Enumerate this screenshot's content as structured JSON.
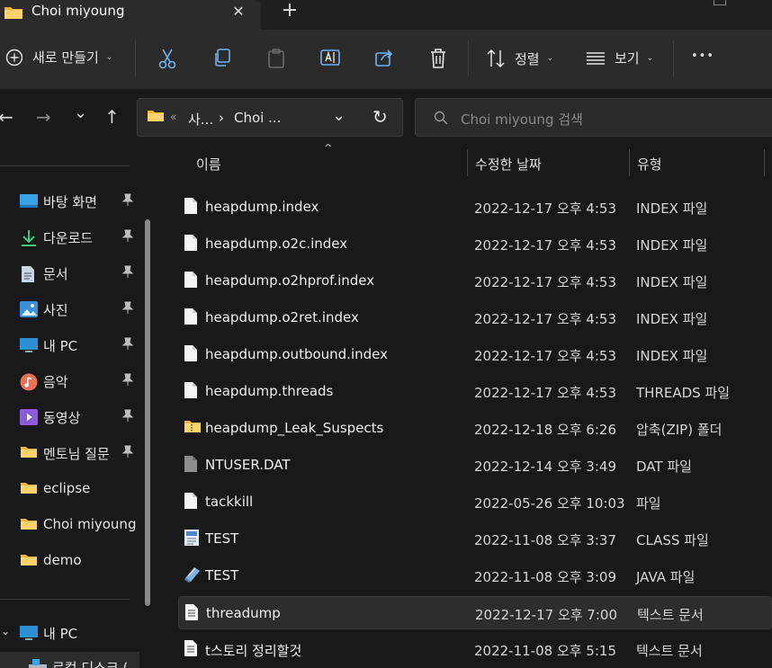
{
  "window": {
    "tab_title": "Choi miyoung",
    "close_glyph": "✕",
    "new_tab_glyph": "+"
  },
  "toolbar": {
    "new_label": "새로 만들기",
    "sort_label": "정렬",
    "view_label": "보기",
    "caret": "⌄",
    "more_glyph": "•••"
  },
  "navigation": {
    "back": "←",
    "forward": "→",
    "recent": "⌄",
    "up": "↑",
    "address": {
      "overflow": "«",
      "crumb1": "사...",
      "sep": "›",
      "crumb2": "Choi ...",
      "dropdown": "⌄",
      "refresh": "↻"
    },
    "search_placeholder": "Choi miyoung 검색"
  },
  "sidebar": {
    "pin_glyph": "📌",
    "items": [
      {
        "label": "바탕 화면",
        "icon": "desktop-icon",
        "pinned": true
      },
      {
        "label": "다운로드",
        "icon": "download-icon",
        "pinned": true
      },
      {
        "label": "문서",
        "icon": "document-icon",
        "pinned": true
      },
      {
        "label": "사진",
        "icon": "pictures-icon",
        "pinned": true
      },
      {
        "label": "내 PC",
        "icon": "pc-icon",
        "pinned": true
      },
      {
        "label": "음악",
        "icon": "music-icon",
        "pinned": true
      },
      {
        "label": "동영상",
        "icon": "video-icon",
        "pinned": true
      },
      {
        "label": "멘토님 질문",
        "icon": "folder-icon",
        "pinned": true
      },
      {
        "label": "eclipse",
        "icon": "folder-icon",
        "pinned": false
      },
      {
        "label": "Choi miyoung",
        "icon": "folder-icon",
        "pinned": false
      },
      {
        "label": "demo",
        "icon": "folder-icon",
        "pinned": false
      }
    ],
    "this_pc": {
      "label": "내 PC",
      "expand": "⌄"
    },
    "local_disk": {
      "label": "로컬 디스크 ("
    }
  },
  "list": {
    "columns": {
      "name": "이름",
      "date": "수정한 날짜",
      "type": "유형"
    },
    "sort_glyph": "^",
    "rows": [
      {
        "name": "heapdump.index",
        "date": "2022-12-17 오후 4:53",
        "type": "INDEX 파일",
        "icon": "file-icon"
      },
      {
        "name": "heapdump.o2c.index",
        "date": "2022-12-17 오후 4:53",
        "type": "INDEX 파일",
        "icon": "file-icon"
      },
      {
        "name": "heapdump.o2hprof.index",
        "date": "2022-12-17 오후 4:53",
        "type": "INDEX 파일",
        "icon": "file-icon"
      },
      {
        "name": "heapdump.o2ret.index",
        "date": "2022-12-17 오후 4:53",
        "type": "INDEX 파일",
        "icon": "file-icon"
      },
      {
        "name": "heapdump.outbound.index",
        "date": "2022-12-17 오후 4:53",
        "type": "INDEX 파일",
        "icon": "file-icon"
      },
      {
        "name": "heapdump.threads",
        "date": "2022-12-17 오후 4:53",
        "type": "THREADS 파일",
        "icon": "file-icon"
      },
      {
        "name": "heapdump_Leak_Suspects",
        "date": "2022-12-18 오후 6:26",
        "type": "압축(ZIP) 폴더",
        "icon": "zip-folder-icon"
      },
      {
        "name": "NTUSER.DAT",
        "date": "2022-12-14 오후 3:49",
        "type": "DAT 파일",
        "icon": "system-file-icon"
      },
      {
        "name": "tackkill",
        "date": "2022-05-26 오후 10:03",
        "type": "파일",
        "icon": "file-icon"
      },
      {
        "name": "TEST",
        "date": "2022-11-08 오후 3:37",
        "type": "CLASS 파일",
        "icon": "class-file-icon"
      },
      {
        "name": "TEST",
        "date": "2022-11-08 오후 3:09",
        "type": "JAVA 파일",
        "icon": "java-file-icon"
      },
      {
        "name": "threadump",
        "date": "2022-12-17 오후 7:00",
        "type": "텍스트 문서",
        "icon": "text-file-icon"
      },
      {
        "name": "t스토리 정리할것",
        "date": "2022-11-08 오후 5:15",
        "type": "텍스트 문서",
        "icon": "text-file-icon"
      }
    ]
  }
}
